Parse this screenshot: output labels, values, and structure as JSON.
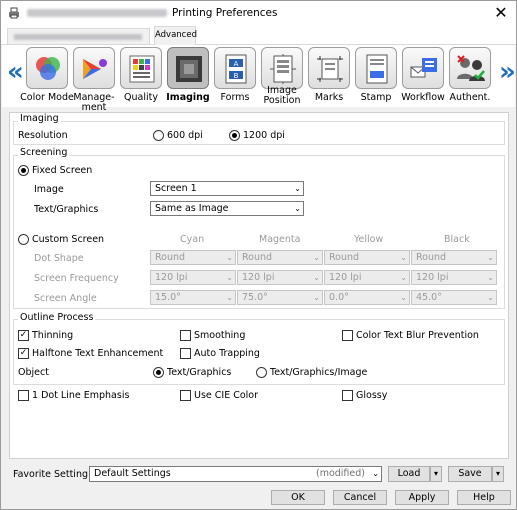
{
  "window": {
    "title": "Printing Preferences",
    "close": "✕"
  },
  "tabs": {
    "advanced": "Advanced"
  },
  "iconbar": {
    "left_arrow": "«",
    "right_arrow": "»",
    "items": [
      {
        "label": "Color Mode"
      },
      {
        "label": "Manage-\nment"
      },
      {
        "label": "Quality"
      },
      {
        "label": "Imaging"
      },
      {
        "label": "Forms"
      },
      {
        "label": "Image\nPosition"
      },
      {
        "label": "Marks"
      },
      {
        "label": "Stamp"
      },
      {
        "label": "Workflow"
      },
      {
        "label": "Authent."
      }
    ],
    "selected": "Imaging"
  },
  "imaging": {
    "header": "Imaging",
    "resolution_label": "Resolution",
    "res_600": "600 dpi",
    "res_1200": "1200 dpi",
    "resolution_selected": "1200 dpi"
  },
  "screening": {
    "header": "Screening",
    "fixed_screen": "Fixed Screen",
    "image_label": "Image",
    "image_value": "Screen 1",
    "text_graphics_label": "Text/Graphics",
    "text_graphics_value": "Same as Image",
    "custom_screen": "Custom Screen",
    "col_cyan": "Cyan",
    "col_magenta": "Magenta",
    "col_yellow": "Yellow",
    "col_black": "Black",
    "dot_shape": "Dot Shape",
    "screen_frequency": "Screen Frequency",
    "screen_angle": "Screen Angle",
    "dot": [
      "Round",
      "Round",
      "Round",
      "Round"
    ],
    "freq": [
      "120 lpi",
      "120 lpi",
      "120 lpi",
      "120 lpi"
    ],
    "angle": [
      "15.0°",
      "75.0°",
      "0.0°",
      "45.0°"
    ]
  },
  "outline": {
    "header": "Outline Process",
    "thinning": "Thinning",
    "smoothing": "Smoothing",
    "color_text_blur": "Color Text Blur Prevention",
    "halftone": "Halftone Text Enhancement",
    "auto_trapping": "Auto Trapping",
    "object_label": "Object",
    "obj_text_graphics": "Text/Graphics",
    "obj_text_graphics_image": "Text/Graphics/Image"
  },
  "misc": {
    "dot_line": "1 Dot Line Emphasis",
    "use_cie": "Use CIE Color",
    "glossy": "Glossy"
  },
  "favorite": {
    "label": "Favorite Setting",
    "value": "Default Settings",
    "modified": "(modified)",
    "load": "Load",
    "save": "Save"
  },
  "buttons": {
    "ok": "OK",
    "cancel": "Cancel",
    "apply": "Apply",
    "help": "Help"
  },
  "colors": {
    "accent": "#1e6fb8"
  }
}
